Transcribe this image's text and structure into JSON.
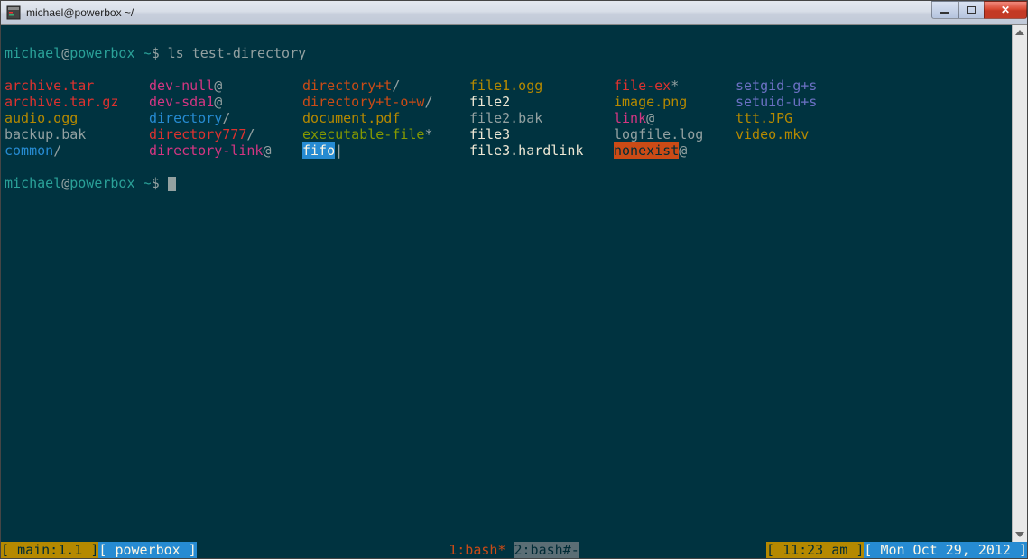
{
  "window": {
    "title": "michael@powerbox ~/"
  },
  "prompt": {
    "user": "michael",
    "host": "powerbox",
    "path": "~",
    "sep": "@",
    "sigil": "$"
  },
  "command": "ls test-directory",
  "ls": {
    "col1": [
      {
        "text": "archive.tar",
        "class": "c-red"
      },
      {
        "text": "archive.tar.gz",
        "class": "c-red"
      },
      {
        "text": "audio.ogg",
        "class": "c-yellow"
      },
      {
        "text": "backup.bak",
        "class": "c-fg"
      },
      {
        "text": "common",
        "class": "c-blue",
        "suffix": "/"
      }
    ],
    "col2": [
      {
        "text": "dev-null",
        "class": "c-magenta",
        "suffix": "@"
      },
      {
        "text": "dev-sda1",
        "class": "c-magenta",
        "suffix": "@"
      },
      {
        "text": "directory",
        "class": "c-blue",
        "suffix": "/"
      },
      {
        "text": "directory777",
        "class": "c-red",
        "suffix": "/"
      },
      {
        "text": "directory-link",
        "class": "c-magenta",
        "suffix": "@"
      }
    ],
    "col3": [
      {
        "text": "directory+t",
        "class": "c-orange",
        "suffix": "/"
      },
      {
        "text": "directory+t-o+w",
        "class": "c-orange",
        "suffix": "/"
      },
      {
        "text": "document.pdf",
        "class": "c-yellow"
      },
      {
        "text": "executable-file",
        "class": "c-green",
        "suffix": "*"
      },
      {
        "text": "fifo",
        "class": "bg-blue",
        "suffix": "|"
      }
    ],
    "col4": [
      {
        "text": "file1.ogg",
        "class": "c-yellow"
      },
      {
        "text": "file2",
        "class": "c-white"
      },
      {
        "text": "file2.bak",
        "class": "c-fg"
      },
      {
        "text": "file3",
        "class": "c-white"
      },
      {
        "text": "file3.hardlink",
        "class": "c-white"
      }
    ],
    "col5": [
      {
        "text": "file-ex",
        "class": "c-red",
        "suffix": "*"
      },
      {
        "text": "image.png",
        "class": "c-yellow"
      },
      {
        "text": "link",
        "class": "c-magenta",
        "suffix": "@"
      },
      {
        "text": "logfile.log",
        "class": "c-fg"
      },
      {
        "text": "nonexist",
        "class": "bg-orange",
        "suffix": "@"
      }
    ],
    "col6": [
      {
        "text": "setgid-g+s",
        "class": "c-violet"
      },
      {
        "text": "setuid-u+s",
        "class": "c-violet"
      },
      {
        "text": "ttt.JPG",
        "class": "c-yellow"
      },
      {
        "text": "video.mkv",
        "class": "c-yellow"
      }
    ]
  },
  "status": {
    "left": {
      "session": "main:1.1",
      "host": "powerbox"
    },
    "center": {
      "active": "1:bash*",
      "inactive": "2:bash#-"
    },
    "right": {
      "time": "11:23 am",
      "date": "Mon Oct 29, 2012"
    }
  }
}
